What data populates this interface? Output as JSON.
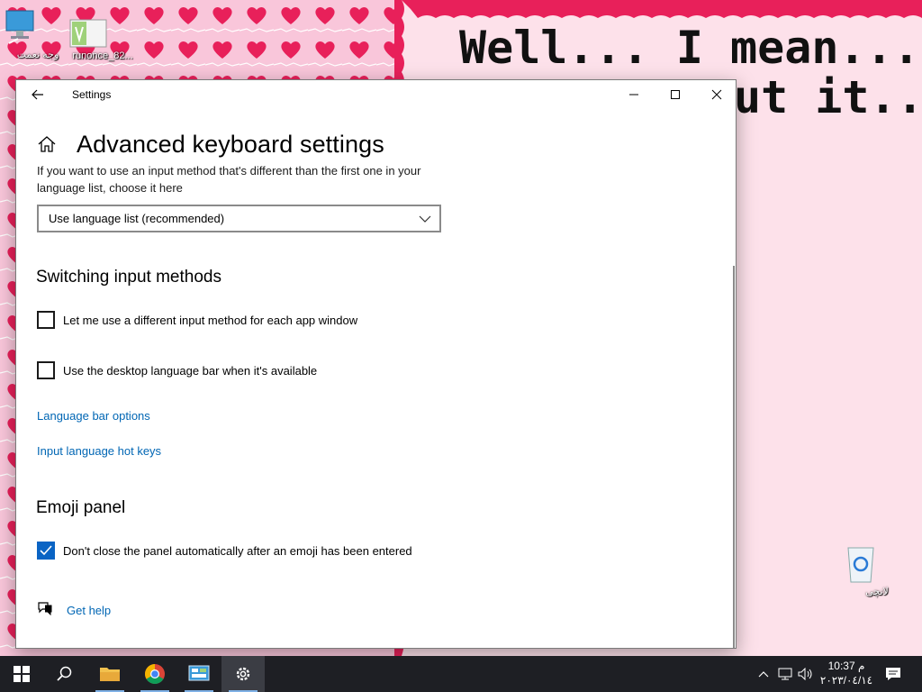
{
  "desktop": {
    "banner_text_line1": "Well... I mean... if",
    "banner_text_line2": "ut it...",
    "icons": [
      {
        "label": "وجه نعمت"
      },
      {
        "label": "runonce_82..."
      },
      {
        "label": "لانچی"
      }
    ]
  },
  "window": {
    "title": "Settings",
    "back_icon": "back-arrow-icon",
    "minimize_icon": "minimize-icon",
    "maximize_icon": "maximize-icon",
    "close_icon": "close-icon"
  },
  "page": {
    "title": "Advanced keyboard settings",
    "intro_text": "If you want to use an input method that's different than the first one in your language list, choose it here",
    "default_input_select": {
      "selected": "Use language list (recommended)"
    },
    "switching": {
      "heading": "Switching input methods",
      "options": [
        {
          "label": "Let me use a different input method for each app window",
          "checked": false
        },
        {
          "label": "Use the desktop language bar when it's available",
          "checked": false
        }
      ],
      "links": [
        "Language bar options",
        "Input language hot keys"
      ]
    },
    "emoji": {
      "heading": "Emoji panel",
      "option": {
        "label": "Don't close the panel automatically after an emoji has been entered",
        "checked": true
      }
    },
    "help_link": "Get help"
  },
  "taskbar": {
    "items": [
      {
        "name": "start",
        "icon": "windows-logo-icon"
      },
      {
        "name": "search",
        "icon": "search-icon"
      },
      {
        "name": "file-explorer",
        "icon": "folder-icon"
      },
      {
        "name": "chrome",
        "icon": "chrome-icon"
      },
      {
        "name": "control-panel",
        "icon": "control-panel-icon"
      },
      {
        "name": "settings",
        "icon": "gear-icon"
      }
    ],
    "clock": {
      "time": "10:37 م",
      "date": "٢٠٢٣/٠٤/١٤"
    }
  },
  "colors": {
    "accent": "#0a64c4",
    "link": "#0066b4",
    "wallpaper_pink": "#f9c6da",
    "heart_red": "#e8205a",
    "taskbar": "#1e1f24"
  }
}
